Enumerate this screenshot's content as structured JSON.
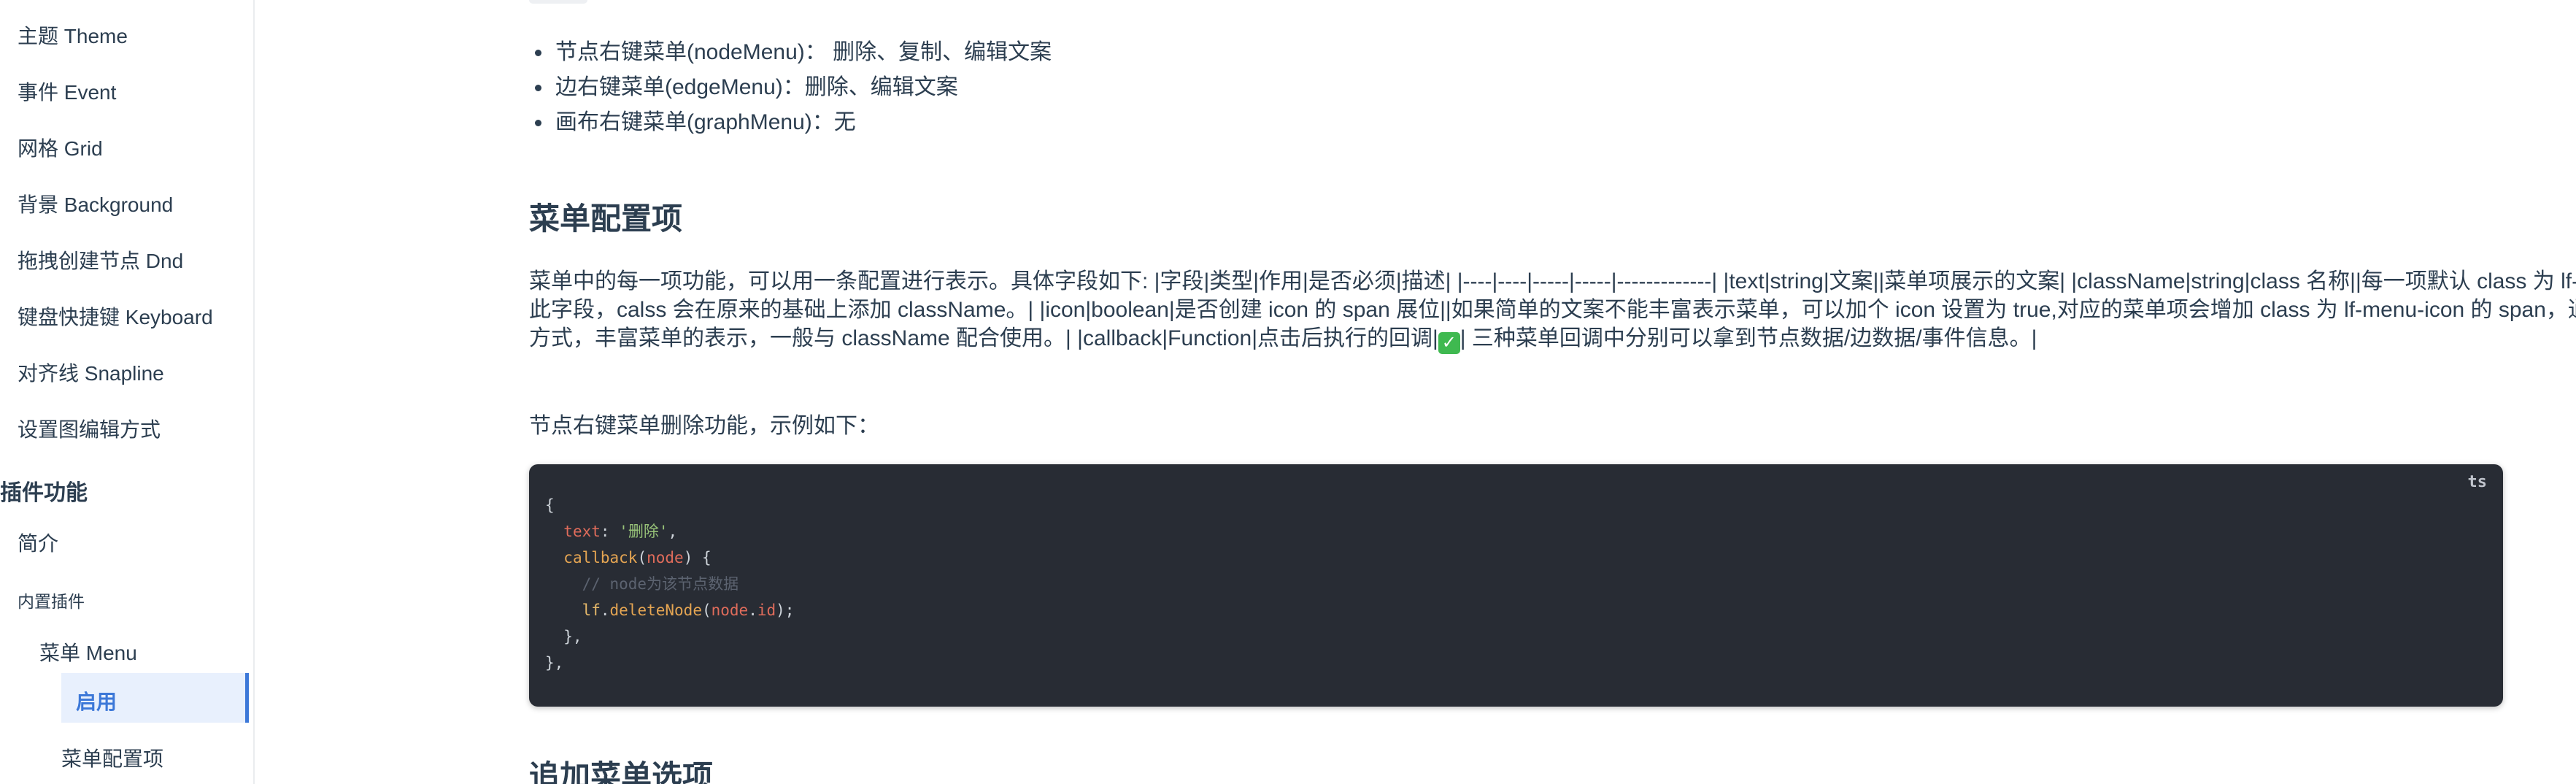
{
  "sidebar": {
    "items": [
      {
        "label": "主题 Theme"
      },
      {
        "label": "事件 Event"
      },
      {
        "label": "网格 Grid"
      },
      {
        "label": "背景 Background"
      },
      {
        "label": "拖拽创建节点 Dnd"
      },
      {
        "label": "键盘快捷键 Keyboard"
      },
      {
        "label": "对齐线 Snapline"
      },
      {
        "label": "设置图编辑方式"
      }
    ],
    "group_title": "插件功能",
    "intro": "简介",
    "builtin_label": "内置插件",
    "menu_item": "菜单 Menu",
    "active_item": "启用",
    "sub_item": "菜单配置项"
  },
  "content": {
    "bullets": [
      "节点右键菜单(nodeMenu)： 删除、复制、编辑文案",
      "边右键菜单(edgeMenu)：删除、编辑文案",
      "画布右键菜单(graphMenu)：无"
    ],
    "section_title": "菜单配置项",
    "paragraph": "菜单中的每一项功能，可以用一条配置进行表示。具体字段如下: |字段|类型|作用|是否必须|描述| |----|----|-----|-----|-------------| |text|string|文案||菜单项展示的文案| |className|string|class 名称||每一项默认 class 为 lf-menu-item，设置了此字段，calss 会在原来的基础上添加 className。| |icon|boolean|是否创建 icon 的 span 展位||如果简单的文案不能丰富表示菜单，可以加个 icon 设置为 true,对应的菜单项会增加 class 为 lf-menu-icon 的 span，通过为其设置背景的方式，丰富菜单的表示，一般与 className 配合使用。| |callback|Function|点击后执行的回调|",
    "paragraph_tail": "| 三种菜单回调中分别可以拿到节点数据/边数据/事件信息。|",
    "example_intro": "节点右键菜单删除功能，示例如下：",
    "code_lang": "ts",
    "next_section_title": "追加菜单选项"
  }
}
